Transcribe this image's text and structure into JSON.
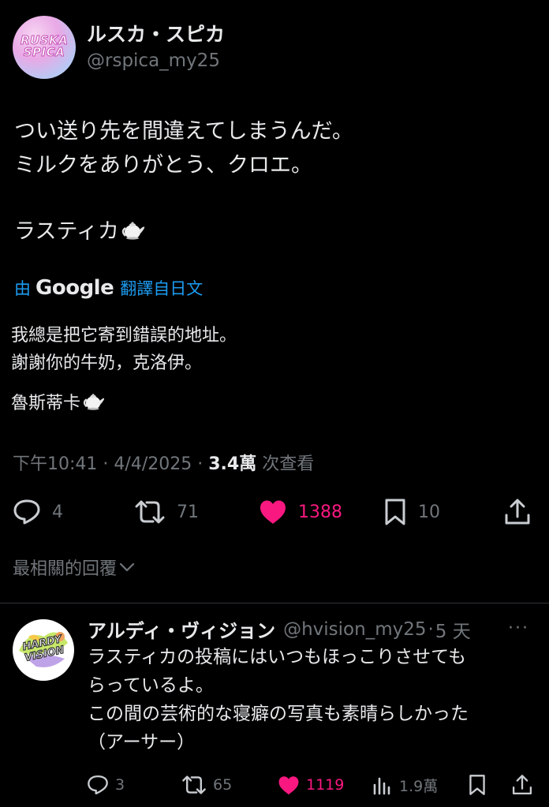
{
  "author": {
    "display_name": "ルスカ・スピカ",
    "handle": "@rspica_my25",
    "avatar_logo_line1": "RUSKA",
    "avatar_logo_line2": "SPICA"
  },
  "tweet": {
    "lines": [
      "つい送り先を間違えてしまうんだ。",
      "ミルクをありがとう、クロエ。"
    ],
    "signature": "ラスティカ",
    "translated_by_prefix": "由",
    "translated_by_brand": "Google",
    "translated_by_suffix": "翻譯自日文",
    "translation_lines": [
      "我總是把它寄到錯誤的地址。",
      "謝謝你的牛奶，克洛伊。"
    ],
    "translation_signature": "魯斯蒂卡",
    "time": "下午10:41",
    "date": "4/4/2025",
    "separator": "·",
    "views": "3.4萬",
    "views_label": "次查看"
  },
  "actions": {
    "replies": "4",
    "retweets": "71",
    "likes": "1388",
    "bookmarks": "10"
  },
  "best_replies_label": "最相關的回覆",
  "reply": {
    "display_name": "アルディ・ヴィジョン",
    "handle": "@hvision_my25",
    "separator": "·",
    "time": "5 天",
    "more": "···",
    "avatar_text_line1": "HARDY",
    "avatar_text_line2": "VISION",
    "lines": [
      "ラスティカの投稿にはいつもほっこりさせても",
      "らっているよ。",
      "この間の芸術的な寝癖の写真も素晴らしかった",
      "（アーサー）"
    ],
    "actions": {
      "replies": "3",
      "retweets": "65",
      "likes": "1119",
      "views": "1.9萬"
    }
  },
  "colors": {
    "background": "#000000",
    "text": "#e7e9ea",
    "muted": "#71767b",
    "link": "#1d9bf0",
    "like": "#f91880",
    "divider": "#2f3336"
  }
}
